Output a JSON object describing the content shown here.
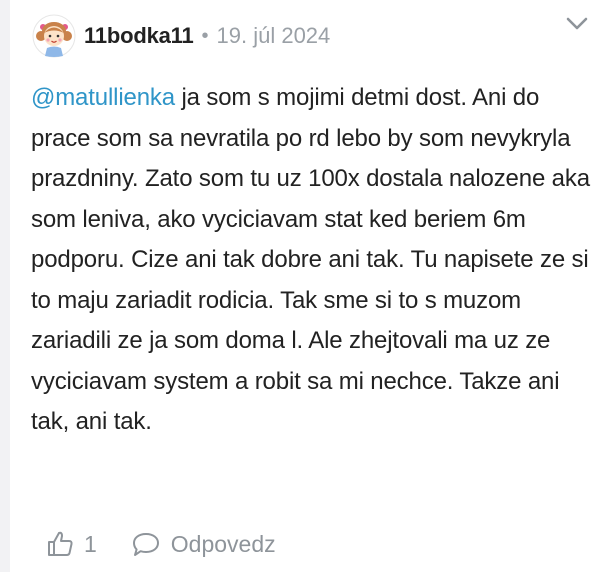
{
  "comment": {
    "author": "11bodka11",
    "separator": "•",
    "date": "19. júl 2024",
    "mention": "@matullienka",
    "text": " ja som s mojimi detmi dost. Ani do prace som sa nevratila po rd lebo by som nevykryla prazdniny. Zato som tu uz 100x dostala nalozene aka som leniva, ako vyciciavam stat ked beriem 6m podporu. Cize ani tak dobre ani tak. Tu napisete ze si to maju zariadit rodicia. Tak sme si to s muzom zariadili ze ja som doma l. Ale zhejtovali ma uz ze vyciciavam system a robit sa mi nechce. Takze ani tak, ani tak.",
    "like_count": "1",
    "reply_label": "Odpovedz"
  },
  "icons": {
    "avatar": "cartoon-girl-avatar",
    "menu": "chevron-down-icon",
    "like": "thumbs-up-icon",
    "reply": "speech-bubble-icon"
  },
  "colors": {
    "mention": "#2f95c8",
    "muted": "#9aa0a6",
    "text": "#222222"
  }
}
